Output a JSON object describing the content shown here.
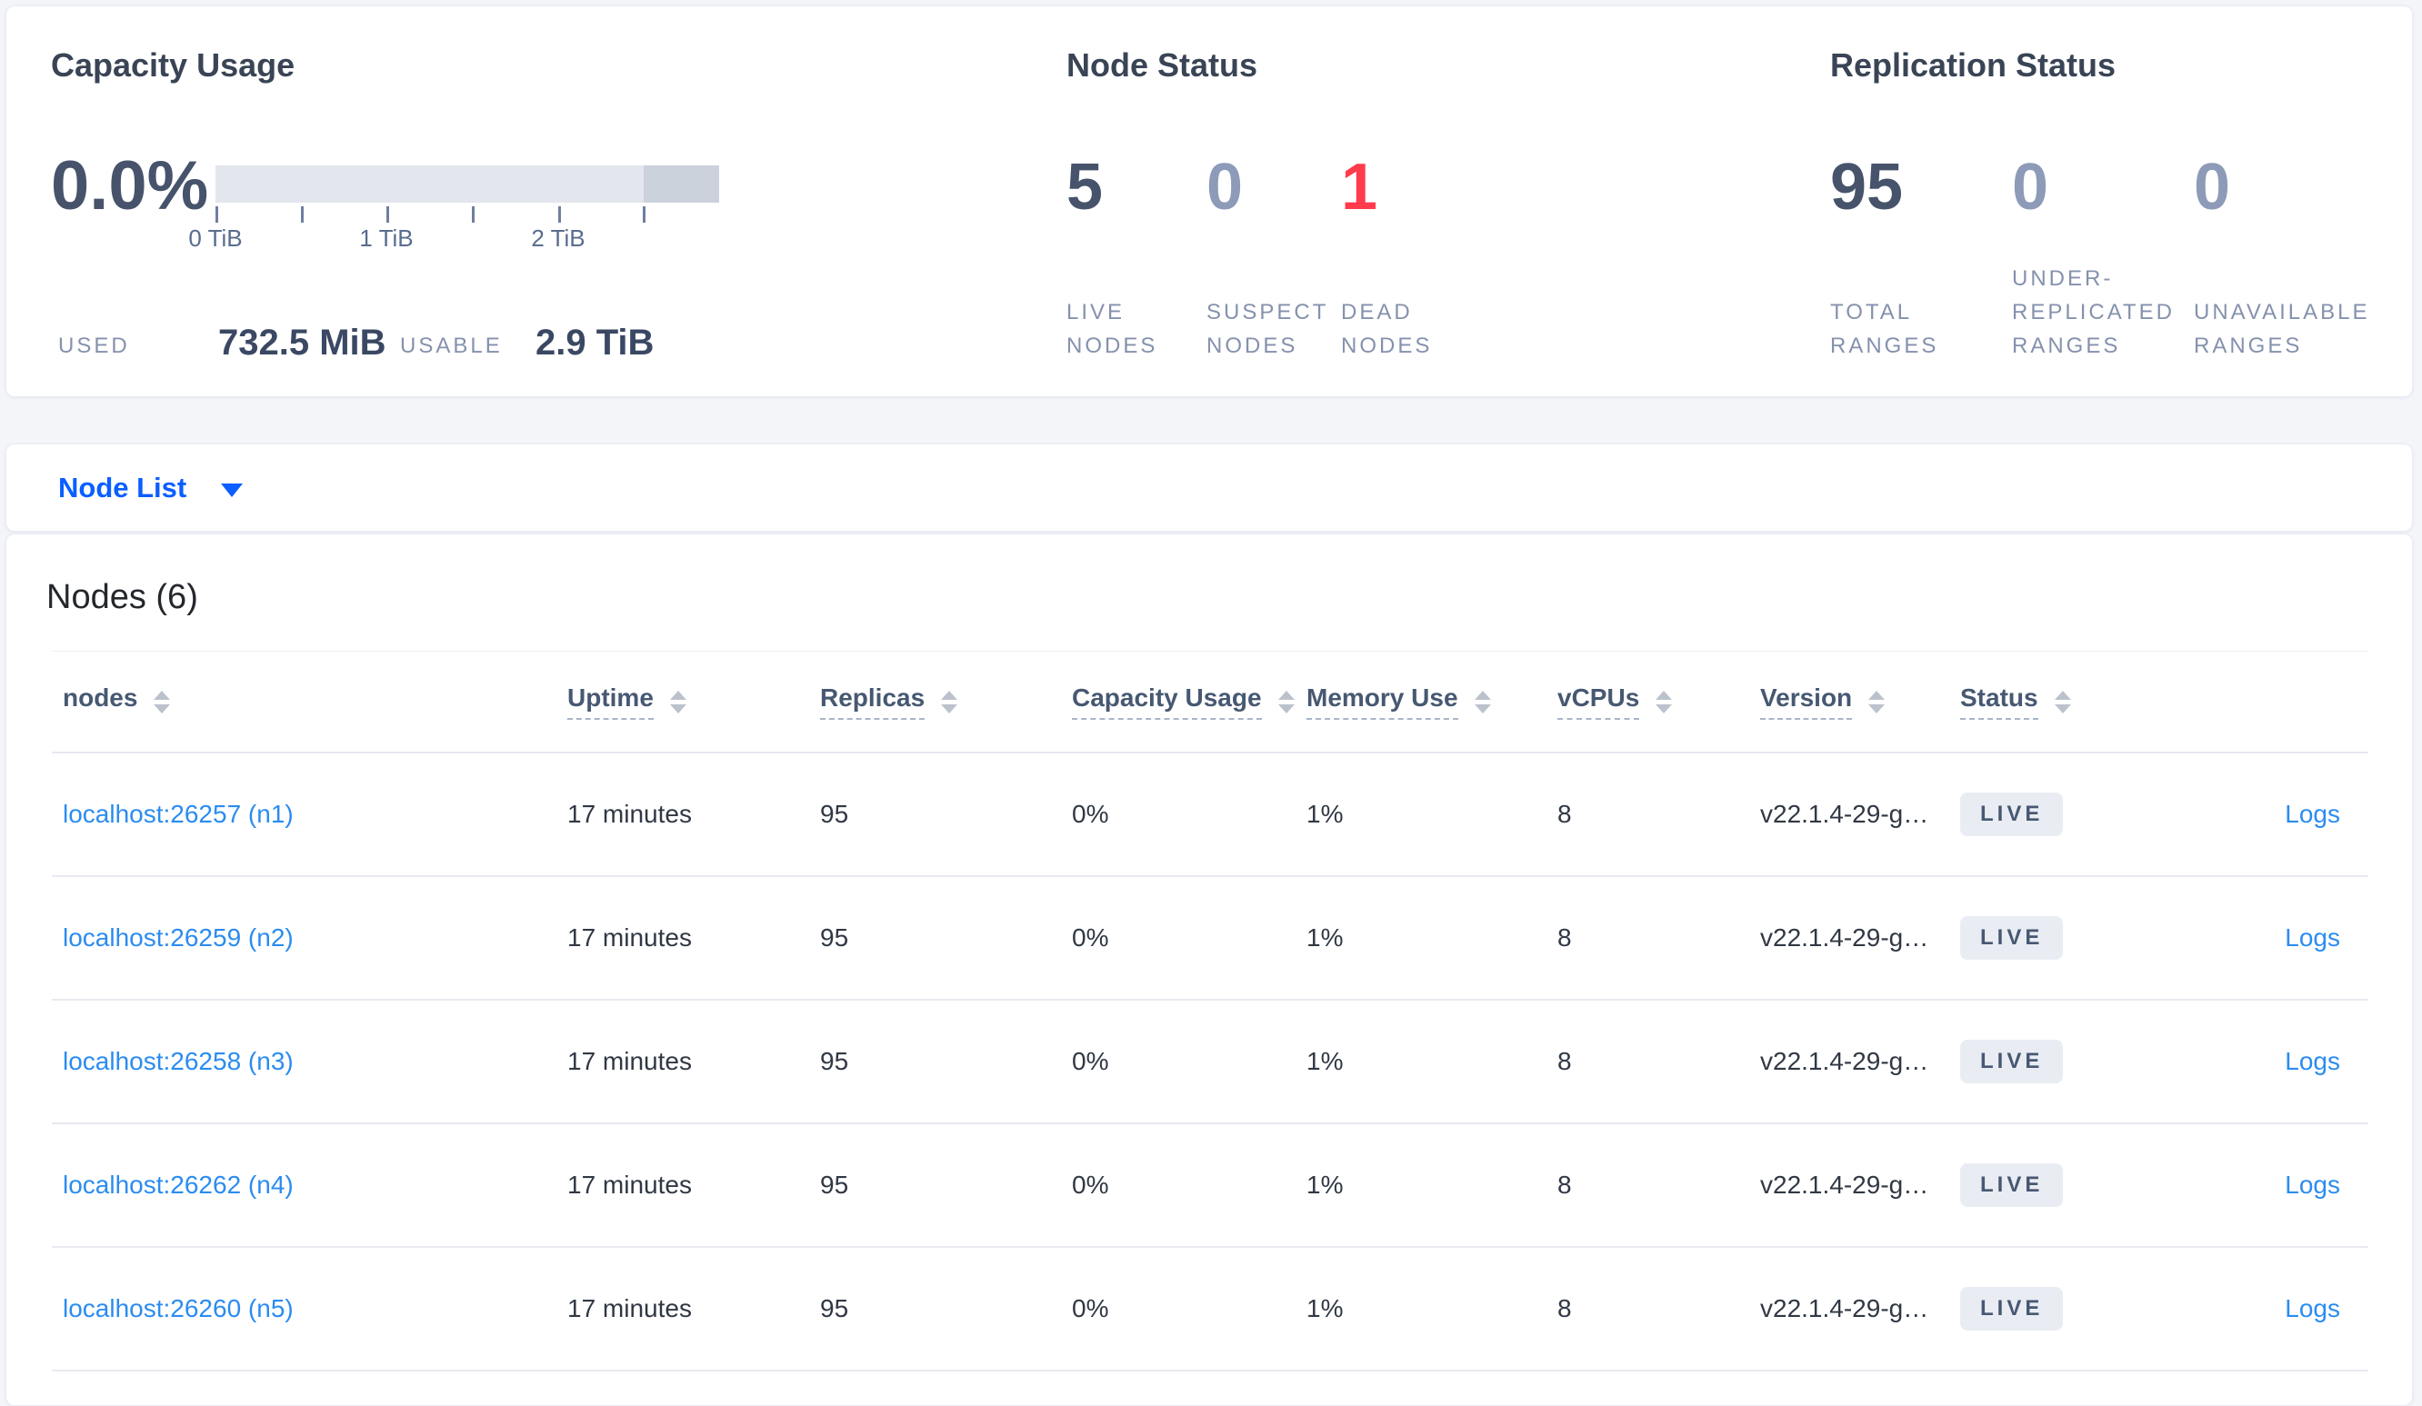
{
  "colors": {
    "accent_blue": "#0b5eff",
    "link_blue": "#2b8cf0",
    "danger_red": "#ff3b4c",
    "stat_dark": "#46536b",
    "stat_muted": "#8d9bb8",
    "badge_bg": "#e9edf3",
    "badge_text": "#475872",
    "bar_light": "#e3e6ed",
    "bar_dark": "#ccd2db"
  },
  "summary": {
    "capacity": {
      "title": "Capacity Usage",
      "percent": "0.0%",
      "bar": {
        "dark_fraction": 0.15
      },
      "axis_ticks": [
        "0 TiB",
        "1 TiB",
        "2 TiB"
      ],
      "used_label": "USED",
      "used_value": "732.5 MiB",
      "usable_label": "USABLE",
      "usable_value": "2.9 TiB"
    },
    "node_status": {
      "title": "Node Status",
      "stats": [
        {
          "value": "5",
          "label": "LIVE NODES",
          "tone": "dark"
        },
        {
          "value": "0",
          "label": "SUSPECT NODES",
          "tone": "muted"
        },
        {
          "value": "1",
          "label": "DEAD NODES",
          "tone": "danger"
        }
      ]
    },
    "replication": {
      "title": "Replication Status",
      "stats": [
        {
          "value": "95",
          "label": "TOTAL RANGES",
          "tone": "dark"
        },
        {
          "value": "0",
          "label": "UNDER-REPLICATED RANGES",
          "tone": "muted"
        },
        {
          "value": "0",
          "label": "UNAVAILABLE RANGES",
          "tone": "muted"
        }
      ]
    }
  },
  "node_list_menu": {
    "label": "Node List"
  },
  "nodes_table": {
    "title": "Nodes (6)",
    "columns": [
      {
        "key": "node",
        "label": "nodes",
        "tooltip": false,
        "sortable": true
      },
      {
        "key": "uptime",
        "label": "Uptime",
        "tooltip": true,
        "sortable": true
      },
      {
        "key": "replicas",
        "label": "Replicas",
        "tooltip": true,
        "sortable": true
      },
      {
        "key": "capacity_usage",
        "label": "Capacity Usage",
        "tooltip": true,
        "sortable": true
      },
      {
        "key": "memory_use",
        "label": "Memory Use",
        "tooltip": true,
        "sortable": true
      },
      {
        "key": "vcpus",
        "label": "vCPUs",
        "tooltip": true,
        "sortable": true
      },
      {
        "key": "version",
        "label": "Version",
        "tooltip": true,
        "sortable": true
      },
      {
        "key": "status",
        "label": "Status",
        "tooltip": true,
        "sortable": true
      },
      {
        "key": "logs",
        "label": "",
        "tooltip": false,
        "sortable": false
      }
    ],
    "rows": [
      {
        "node": "localhost:26257 (n1)",
        "uptime": "17 minutes",
        "replicas": "95",
        "capacity_usage": "0%",
        "memory_use": "1%",
        "vcpus": "8",
        "version": "v22.1.4-29-g…",
        "status": "LIVE",
        "logs": "Logs"
      },
      {
        "node": "localhost:26259 (n2)",
        "uptime": "17 minutes",
        "replicas": "95",
        "capacity_usage": "0%",
        "memory_use": "1%",
        "vcpus": "8",
        "version": "v22.1.4-29-g…",
        "status": "LIVE",
        "logs": "Logs"
      },
      {
        "node": "localhost:26258 (n3)",
        "uptime": "17 minutes",
        "replicas": "95",
        "capacity_usage": "0%",
        "memory_use": "1%",
        "vcpus": "8",
        "version": "v22.1.4-29-g…",
        "status": "LIVE",
        "logs": "Logs"
      },
      {
        "node": "localhost:26262 (n4)",
        "uptime": "17 minutes",
        "replicas": "95",
        "capacity_usage": "0%",
        "memory_use": "1%",
        "vcpus": "8",
        "version": "v22.1.4-29-g…",
        "status": "LIVE",
        "logs": "Logs"
      },
      {
        "node": "localhost:26260 (n5)",
        "uptime": "17 minutes",
        "replicas": "95",
        "capacity_usage": "0%",
        "memory_use": "1%",
        "vcpus": "8",
        "version": "v22.1.4-29-g…",
        "status": "LIVE",
        "logs": "Logs"
      }
    ]
  },
  "stat_layout": {
    "node_status_columns": [
      1166,
      1320,
      1468
    ],
    "node_status_label_width": 150,
    "replication_columns": [
      2006,
      2206,
      2406
    ],
    "replication_label_width": 210
  }
}
